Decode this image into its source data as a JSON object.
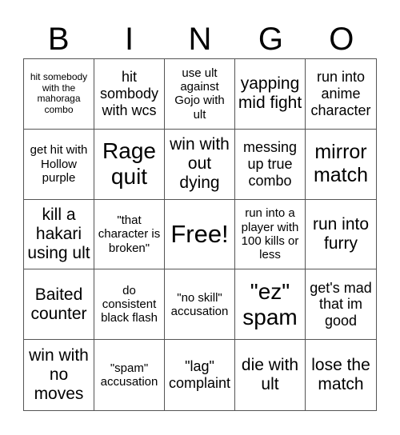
{
  "header": {
    "letters": [
      "B",
      "I",
      "N",
      "G",
      "O"
    ]
  },
  "board": {
    "cells": [
      "hit somebody with the mahoraga combo",
      "hit sombody with wcs",
      "use ult against Gojo with ult",
      "yapping mid fight",
      "run into anime character",
      "get hit with Hollow purple",
      "Rage quit",
      "win with out dying",
      "messing up true combo",
      "mirror match",
      "kill a hakari using ult",
      "\"that character is broken\"",
      "Free!",
      "run into a player with 100 kills or less",
      "run into furry",
      "Baited counter",
      "do consistent black flash",
      "\"no skill\" accusation",
      "\"ez\" spam",
      "get's mad that im good",
      "win with no moves",
      "\"spam\" accusation",
      "\"lag\" complaint",
      "die with ult",
      "lose the match"
    ],
    "free_space_index": 12
  }
}
